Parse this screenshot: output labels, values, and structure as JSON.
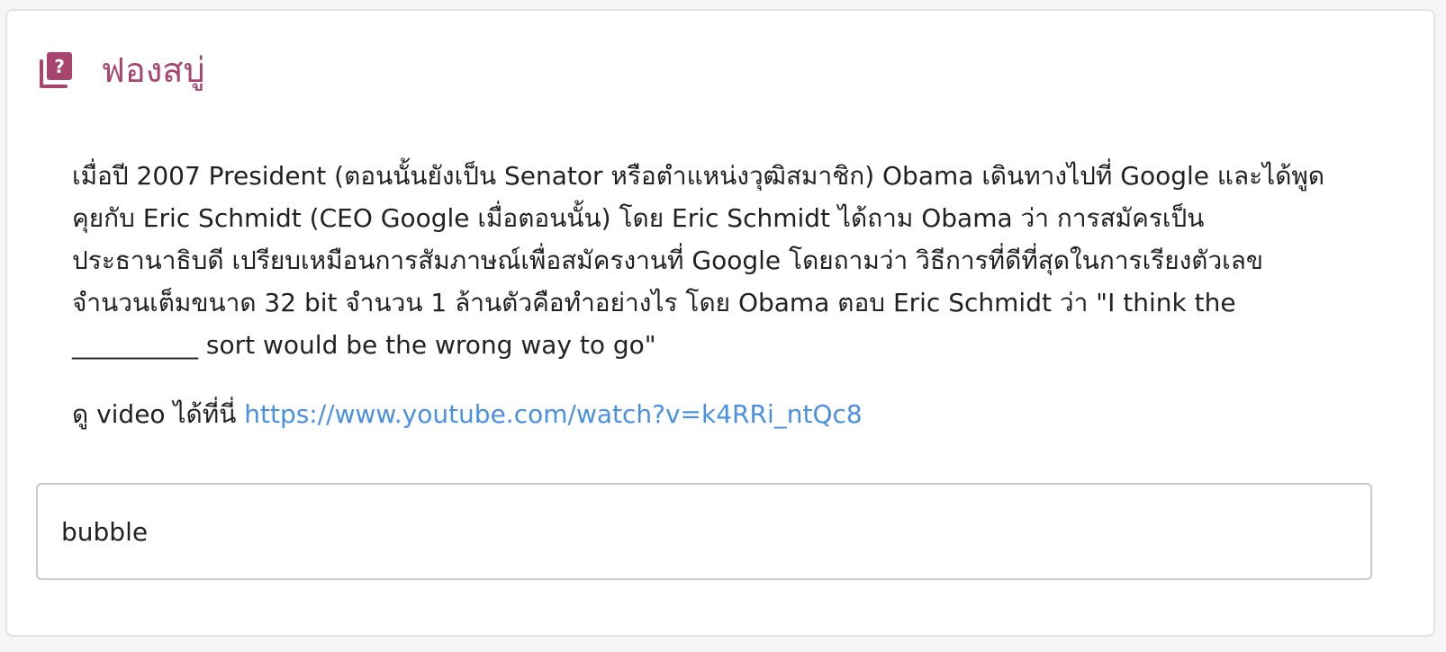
{
  "question": {
    "title": "ฟองสบู่",
    "icon": "question-book-icon",
    "accent_color": "#a8456e",
    "body_text": "เมื่อปี 2007 President (ตอนนั้นยังเป็น Senator หรือตำแหน่งวุฒิสมาชิก) Obama เดินทางไปที่ Google และได้พูดคุยกับ Eric Schmidt (CEO Google เมื่อตอนนั้น) โดย Eric Schmidt ได้ถาม Obama ว่า การสมัครเป็นประธานาธิบดี เปรียบเหมือนการสัมภาษณ์เพื่อสมัครงานที่ Google โดยถามว่า วิธีการที่ดีที่สุดในการเรียงตัวเลขจำนวนเต็มขนาด 32 bit จำนวน 1 ล้านตัวคือทำอย่างไร โดย Obama ตอบ Eric Schmidt ว่า \"I think the __________ sort would be the wrong way to go\"",
    "video_prefix": "ดู video ได้ที่นี่",
    "video_url": "https://www.youtube.com/watch?v=k4RRi_ntQc8",
    "link_color": "#4a90e2"
  },
  "answer": {
    "value": "bubble"
  }
}
